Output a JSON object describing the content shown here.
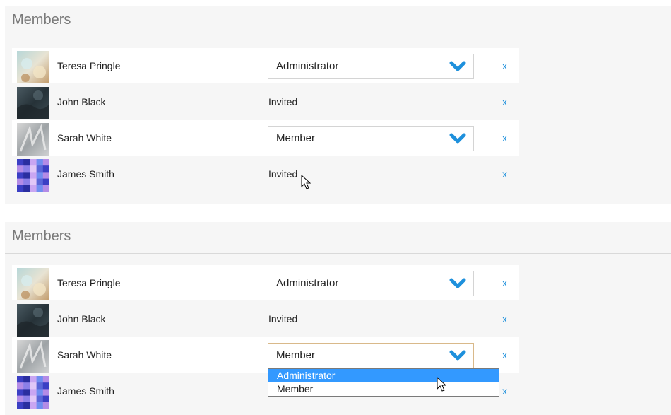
{
  "colors": {
    "accent": "#1e90dc",
    "panel_bg": "#f6f6f6",
    "highlight": "#3399ff"
  },
  "panels": [
    {
      "title": "Members",
      "members": [
        {
          "name": "Teresa Pringle",
          "role": "Administrator",
          "remove": "x",
          "avatar": "blurred-lights"
        },
        {
          "name": "John Black",
          "status": "Invited",
          "remove": "x",
          "avatar": "dark-texture"
        },
        {
          "name": "Sarah White",
          "role": "Member",
          "remove": "x",
          "avatar": "gray-frost"
        },
        {
          "name": "James Smith",
          "status": "Invited",
          "remove": "x",
          "avatar": "purple-mosaic"
        }
      ]
    },
    {
      "title": "Members",
      "members": [
        {
          "name": "Teresa Pringle",
          "role": "Administrator",
          "remove": "x",
          "avatar": "blurred-lights"
        },
        {
          "name": "John Black",
          "status": "Invited",
          "remove": "x",
          "avatar": "dark-texture"
        },
        {
          "name": "Sarah White",
          "role": "Member",
          "remove": "x",
          "avatar": "gray-frost"
        },
        {
          "name": "James Smith",
          "remove": "x",
          "avatar": "purple-mosaic"
        }
      ],
      "dropdown": {
        "options": [
          "Administrator",
          "Member"
        ],
        "highlighted": "Administrator"
      }
    }
  ]
}
